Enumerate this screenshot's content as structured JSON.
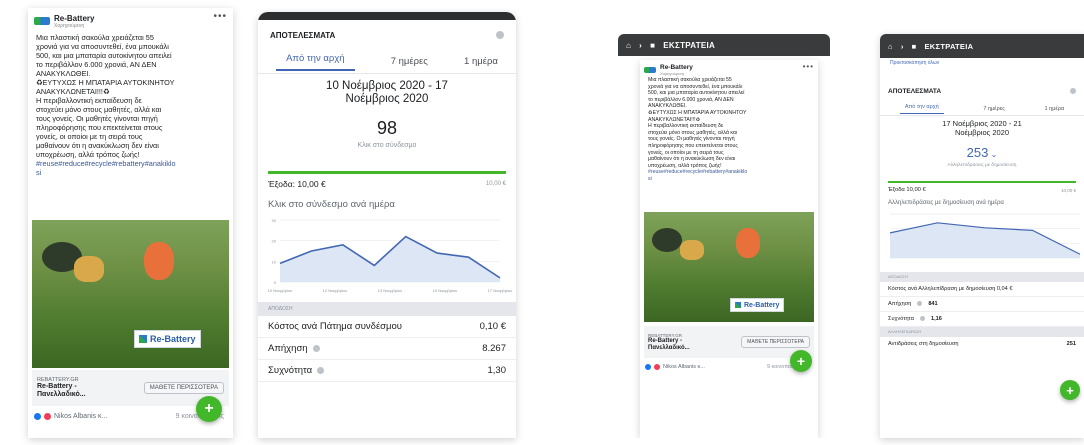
{
  "post": {
    "page_name": "Re-Battery",
    "sponsored": "Χορηγούμενη",
    "menu": "•••",
    "text": "Μια πλαστική σακούλα χρειάζεται 55\nχρονιά για να αποσυντεθεί, ένα μπουκάλι\n500, και μια μπαταρία αυτοκίνητου απειλεί\nτο περιβάλλον 6.000 χρονιά, ΑΝ ΔΕΝ\nΑΝΑΚΥΚΛΩΘΕΙ.\n♻ΕΥΤΥΧΩΣ Η ΜΠΑΤΑΡΙΑ ΑΥΤΟΚΙΝΗΤΟΥ\nΑΝΑΚΥΚΛΩΝΕΤΑΙ!!!♻\nΗ περιβαλλοντική εκπαίδευση δε\nστοχεύει μόνο στους μαθητές, αλλά και\nτους γονείς. Οι μαθητές γίνονται πηγή\nπληροφόρησης που επεκτείνεται στους\nγονείς, οι οποίοι με τη σειρά τους\nμαθαίνουν ότι η ανακύκλωση δεν είναι\nυποχρέωση, αλλά τρόπος ζωής!",
    "hashtags": "#reuse#reduce#recycle#rebattery#anakiklo\nsi",
    "image_brand": "Re-Battery",
    "link_domain": "REBATTERY.GR",
    "link_title": "Re-Battery -\nΠανελλαδικό...",
    "learn_more": "ΜΑΘΕΤΕ ΠΕΡΙΣΣΟΤΕΡΑ",
    "reactors": "Nikos Albanis κ...",
    "shares": "9 κοινοποιήσεις",
    "fab": "+"
  },
  "results1": {
    "title": "ΑΠΟΤΕΛΕΣΜΑΤΑ",
    "tabs": [
      "Από την αρχή",
      "7 ημέρες",
      "1 ημέρα"
    ],
    "date_range": "10 Νοέμβριος 2020 - 17\nΝοέμβριος 2020",
    "metric_value": "98",
    "metric_label": "Κλικ στο σύνδεσμο",
    "spend_label": "Έξοδα: 10,00 €",
    "spend_total": "10,00 €",
    "chart_title": "Κλικ στο σύνδεσμο ανά ημέρα",
    "section": "ΑΠΟΔΟΣΗ",
    "rows": [
      {
        "label": "Κόστος ανά Πάτημα συνδέσμου",
        "value": "0,10 €"
      },
      {
        "label": "Απήχηση",
        "value": "8.267"
      },
      {
        "label": "Συχνότητα",
        "value": "1,30"
      }
    ]
  },
  "campaign_header": {
    "home_icon": "home-icon",
    "label": "ΕΚΣΤΡΑΤΕΙΑ"
  },
  "results2": {
    "header": "ΕΚΣΤΡΑΤΕΙΑ",
    "preview_link": "Προεπισκόπηση όλων",
    "title": "ΑΠΟΤΕΛΕΣΜΑΤΑ",
    "tabs": [
      "Από την αρχή",
      "7 ημέρες",
      "1 ημέρα"
    ],
    "date_range": "17 Νοέμβριος 2020 - 21\nΝοέμβριος 2020",
    "metric_value": "253",
    "metric_label": "Αλληλεπιδράσεις με δημοσίευση",
    "spend_label": "Έξοδα 10,00 €",
    "spend_total": "10,00 €",
    "chart_title": "Αλληλεπιδράσεις με δημοσίευση ανά ημέρα",
    "section": "ΑΠΟΔΟΣΗ",
    "cost_row": "Κόστος ανά Αλληλεπίδραση με δημοσίευση 0,04 €",
    "reach_label": "Απήχηση",
    "reach_value": "841",
    "freq_label": "Συχνότητα",
    "freq_value": "1,16",
    "section2": "ΑΛΛΗΛΕΠΙΔΡΑΣΗ",
    "reactions_label": "Αντιδράσεις στη δημοσίευση",
    "reactions_value": "251"
  },
  "chart_data": [
    {
      "type": "line",
      "title": "Κλικ στο σύνδεσμο ανά ημέρα",
      "x": [
        "10 Νοεμβρίου",
        "12 Νοεμβρίου",
        "13 Νοεμβρίου",
        "15 Νοεμβρίου",
        "17 Νοεμβρίου"
      ],
      "series": [
        {
          "values": [
            9,
            15,
            18,
            8,
            22,
            14,
            12,
            2
          ]
        }
      ],
      "ylim": [
        0,
        30
      ],
      "yticks": [
        "30",
        "20",
        "10",
        "0"
      ],
      "colors": {
        "line": "#4267b2",
        "fill": "#dce6f5"
      }
    },
    {
      "type": "line",
      "title": "Αλληλεπιδράσεις με δημοσίευση ανά ημέρα",
      "series": [
        {
          "values": [
            20,
            28,
            24,
            22,
            3
          ]
        }
      ],
      "ylim": [
        0,
        35
      ],
      "colors": {
        "line": "#4267b2",
        "fill": "#dce6f5"
      }
    }
  ]
}
